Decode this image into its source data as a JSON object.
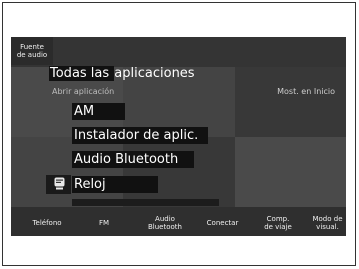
{
  "header": {
    "source_button": "Fuente\nde audio"
  },
  "apps": {
    "title_prefix": "Todas las ",
    "title_rest": "aplicaciones",
    "open_label": "Abrir aplicación",
    "show_home_label": "Most. en Inicio",
    "items": [
      {
        "label": "AM"
      },
      {
        "label": "Instalador de aplic."
      },
      {
        "label": "Audio Bluetooth"
      },
      {
        "label": "Reloj",
        "icon": "clock-app-icon"
      }
    ]
  },
  "nav": {
    "items": [
      {
        "label": "Teléfono"
      },
      {
        "label": "FM"
      },
      {
        "label": "Audio\nBluetooth"
      },
      {
        "label": "Conectar"
      },
      {
        "label": "Comp.\nde viaje"
      },
      {
        "label": "Modo de\nvisual."
      }
    ]
  },
  "colors": {
    "screen_bg": "#3e3e3e",
    "selection_bg": "#111111",
    "text": "#ffffff"
  }
}
